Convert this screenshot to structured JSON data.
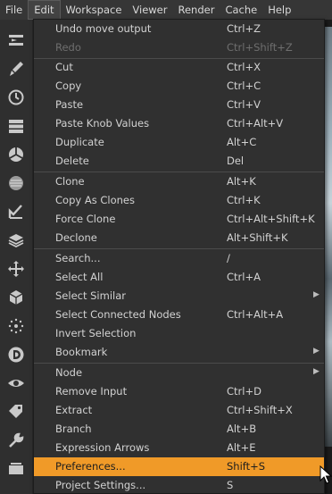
{
  "menubar": {
    "items": [
      "File",
      "Edit",
      "Workspace",
      "Viewer",
      "Render",
      "Cache",
      "Help"
    ]
  },
  "toolbar": {
    "icons": [
      "input-icon",
      "paint-brush-icon",
      "clock-icon",
      "channels-icon",
      "color-wheel-icon",
      "filter-icon",
      "keyer-icon",
      "merge-icon",
      "transform-icon",
      "3d-cube-icon",
      "particles-icon",
      "deep-icon",
      "views-icon",
      "metadata-tag-icon",
      "toolsets-icon",
      "other-icon"
    ]
  },
  "edit_menu": {
    "items": [
      {
        "label": "Undo move output",
        "shortcut": "Ctrl+Z"
      },
      {
        "label": "Redo",
        "shortcut": "Ctrl+Shift+Z",
        "disabled": true
      },
      {
        "label": "Cut",
        "shortcut": "Ctrl+X"
      },
      {
        "label": "Copy",
        "shortcut": "Ctrl+C"
      },
      {
        "label": "Paste",
        "shortcut": "Ctrl+V"
      },
      {
        "label": "Paste Knob Values",
        "shortcut": "Ctrl+Alt+V"
      },
      {
        "label": "Duplicate",
        "shortcut": "Alt+C"
      },
      {
        "label": "Delete",
        "shortcut": "Del"
      },
      {
        "label": "Clone",
        "shortcut": "Alt+K"
      },
      {
        "label": "Copy As Clones",
        "shortcut": "Ctrl+K"
      },
      {
        "label": "Force Clone",
        "shortcut": "Ctrl+Alt+Shift+K"
      },
      {
        "label": "Declone",
        "shortcut": "Alt+Shift+K"
      },
      {
        "label": "Search...",
        "shortcut": "/"
      },
      {
        "label": "Select All",
        "shortcut": "Ctrl+A"
      },
      {
        "label": "Select Similar",
        "shortcut": "",
        "submenu": true
      },
      {
        "label": "Select Connected Nodes",
        "shortcut": "Ctrl+Alt+A"
      },
      {
        "label": "Invert Selection",
        "shortcut": ""
      },
      {
        "label": "Bookmark",
        "shortcut": "",
        "submenu": true
      },
      {
        "label": "Node",
        "shortcut": "",
        "submenu": true
      },
      {
        "label": "Remove Input",
        "shortcut": "Ctrl+D"
      },
      {
        "label": "Extract",
        "shortcut": "Ctrl+Shift+X"
      },
      {
        "label": "Branch",
        "shortcut": "Alt+B"
      },
      {
        "label": "Expression Arrows",
        "shortcut": "Alt+E"
      },
      {
        "label": "Preferences...",
        "shortcut": "Shift+S",
        "highlighted": true
      },
      {
        "label": "Project Settings...",
        "shortcut": "S"
      }
    ],
    "submenu_arrow": "▶"
  },
  "colors": {
    "accent": "#f09a28",
    "menu_bg": "#303030",
    "text": "#d2d2d2",
    "disabled_text": "#6e6e6e"
  }
}
